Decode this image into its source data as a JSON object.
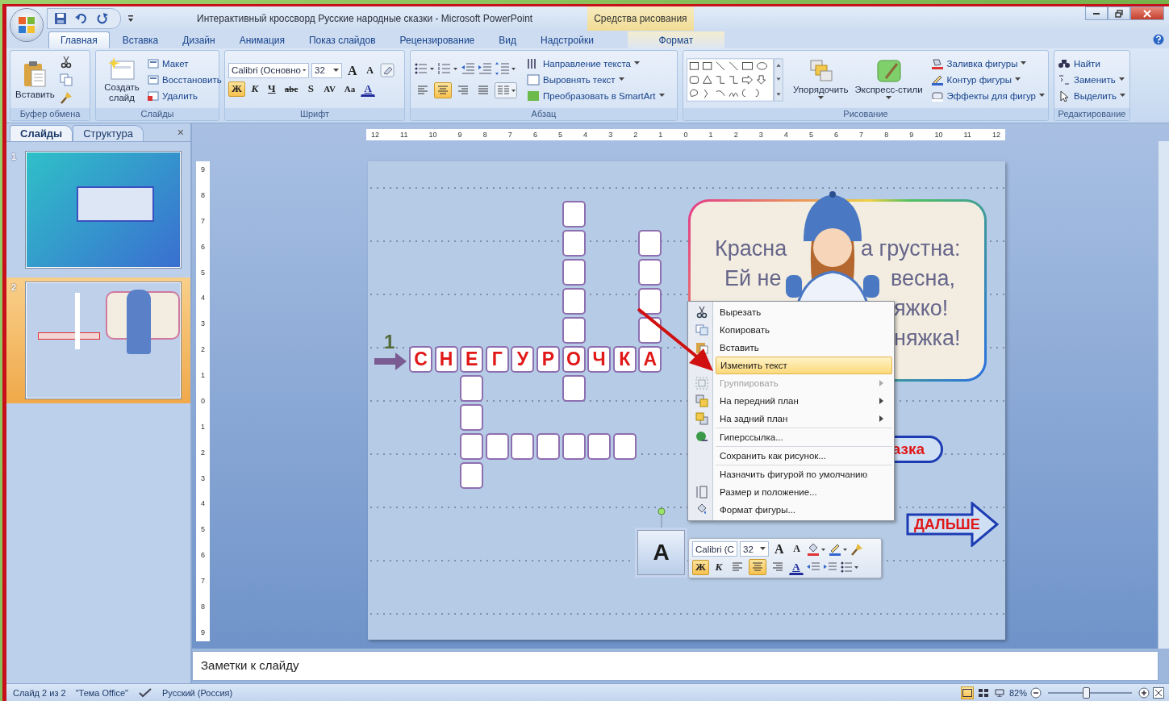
{
  "window": {
    "title": "Интерактивный кроссворд Русские народные сказки - Microsoft PowerPoint",
    "context_label": "Средства рисования"
  },
  "tabs": [
    {
      "label": "Главная",
      "selected": true
    },
    {
      "label": "Вставка",
      "selected": false
    },
    {
      "label": "Дизайн",
      "selected": false
    },
    {
      "label": "Анимация",
      "selected": false
    },
    {
      "label": "Показ слайдов",
      "selected": false
    },
    {
      "label": "Рецензирование",
      "selected": false
    },
    {
      "label": "Вид",
      "selected": false
    },
    {
      "label": "Надстройки",
      "selected": false
    }
  ],
  "contextual_tab": {
    "label": "Формат",
    "selected": false
  },
  "ribbon": {
    "clipboard": {
      "title": "Буфер обмена",
      "paste": "Вставить"
    },
    "slides": {
      "title": "Слайды",
      "new_slide": "Создать слайд",
      "items": [
        "Макет",
        "Восстановить",
        "Удалить"
      ]
    },
    "font": {
      "title": "Шрифт",
      "font_name": "Calibri (Основно",
      "font_size": "32",
      "size_buttons": [
        "A",
        "A"
      ],
      "buttons": [
        {
          "label": "Ж",
          "selected": true
        },
        {
          "label": "К",
          "selected": false
        },
        {
          "label": "Ч",
          "selected": false
        },
        {
          "label": "abc",
          "selected": false
        },
        {
          "label": "S",
          "selected": false
        },
        {
          "label": "AV",
          "selected": false
        },
        {
          "label": "Aa",
          "selected": false
        },
        {
          "label": "A",
          "selected": false
        }
      ]
    },
    "paragraph": {
      "title": "Абзац",
      "items": [
        "Направление текста",
        "Выровнять текст",
        "Преобразовать в SmartArt"
      ],
      "align": [
        {
          "selected": false
        },
        {
          "selected": true
        },
        {
          "selected": false
        },
        {
          "selected": false
        }
      ]
    },
    "drawing": {
      "title": "Рисование",
      "arrange": "Упорядочить",
      "quick_styles": "Экспресс-стили",
      "items": [
        "Заливка фигуры",
        "Контур фигуры",
        "Эффекты для фигур"
      ]
    },
    "editing": {
      "title": "Редактирование",
      "items": [
        "Найти",
        "Заменить",
        "Выделить"
      ]
    }
  },
  "slides_panel": {
    "tabs": [
      {
        "label": "Слайды",
        "selected": true
      },
      {
        "label": "Структура",
        "selected": false
      }
    ],
    "close": "×",
    "thumbnails": [
      {
        "number": "1",
        "selected": false
      },
      {
        "number": "2",
        "selected": true
      }
    ]
  },
  "ruler": {
    "horizontal": [
      "12",
      "11",
      "10",
      "9",
      "8",
      "7",
      "6",
      "5",
      "4",
      "3",
      "2",
      "1",
      "0",
      "1",
      "2",
      "3",
      "4",
      "5",
      "6",
      "7",
      "8",
      "9",
      "10",
      "11",
      "12"
    ],
    "vertical": [
      "9",
      "8",
      "7",
      "6",
      "5",
      "4",
      "3",
      "2",
      "1",
      "0",
      "1",
      "2",
      "3",
      "4",
      "5",
      "6",
      "7",
      "8",
      "9"
    ]
  },
  "slide": {
    "crossword": {
      "number": "1",
      "letters": [
        "С",
        "Н",
        "Е",
        "Г",
        "У",
        "Р",
        "О",
        "Ч",
        "К",
        "А"
      ]
    },
    "card": {
      "left": [
        "Красна",
        "Ей не"
      ],
      "right": [
        "а грустна:",
        "весна,",
        "яжко!",
        "няжка!"
      ]
    },
    "hint_button": "азка",
    "next_button": "ДАЛЬШЕ",
    "textbox": "A"
  },
  "context_menu": [
    {
      "kind": "cut",
      "label": "Вырезать",
      "selected": false,
      "disabled": false,
      "submenu": false,
      "divider": false
    },
    {
      "kind": "copy",
      "label": "Копировать",
      "selected": false,
      "disabled": false,
      "submenu": false,
      "divider": false
    },
    {
      "kind": "paste",
      "label": "Вставить",
      "selected": false,
      "disabled": false,
      "submenu": false,
      "divider": false
    },
    {
      "kind": "plain",
      "label": "Изменить текст",
      "selected": true,
      "disabled": false,
      "submenu": false,
      "divider": true
    },
    {
      "kind": "group",
      "label": "Группировать",
      "selected": false,
      "disabled": true,
      "submenu": true,
      "divider": false
    },
    {
      "kind": "front",
      "label": "На передний план",
      "selected": false,
      "disabled": false,
      "submenu": true,
      "divider": false
    },
    {
      "kind": "back",
      "label": "На задний план",
      "selected": false,
      "disabled": false,
      "submenu": true,
      "divider": false
    },
    {
      "kind": "link",
      "label": "Гиперссылка...",
      "selected": false,
      "disabled": false,
      "submenu": false,
      "divider": true
    },
    {
      "kind": "plain",
      "label": "Сохранить как рисунок...",
      "selected": false,
      "disabled": false,
      "submenu": false,
      "divider": true
    },
    {
      "kind": "plain",
      "label": "Назначить фигурой по умолчанию",
      "selected": false,
      "disabled": false,
      "submenu": false,
      "divider": true
    },
    {
      "kind": "size",
      "label": "Размер и положение...",
      "selected": false,
      "disabled": false,
      "submenu": false,
      "divider": false
    },
    {
      "kind": "format",
      "label": "Формат фигуры...",
      "selected": false,
      "disabled": false,
      "submenu": false,
      "divider": false
    }
  ],
  "mini_toolbar": {
    "font_name": "Calibri (С",
    "font_size": "32",
    "size_buttons": [
      "A",
      "A"
    ],
    "buttons": [
      {
        "label": "Ж",
        "selected": true
      },
      {
        "label": "К",
        "selected": false
      }
    ],
    "align": [
      {
        "selected": false
      },
      {
        "selected": true
      },
      {
        "selected": false
      }
    ],
    "color_button": "A"
  },
  "notes": {
    "placeholder": "Заметки к слайду"
  },
  "status_bar": {
    "slide": "Слайд 2 из 2",
    "theme": "\"Тема Office\"",
    "language": "Русский (Россия)",
    "views": [
      {
        "selected": true
      },
      {
        "selected": false
      },
      {
        "selected": false
      }
    ],
    "zoom": "82%",
    "zoom_slider": {
      "level": 0.44
    }
  }
}
